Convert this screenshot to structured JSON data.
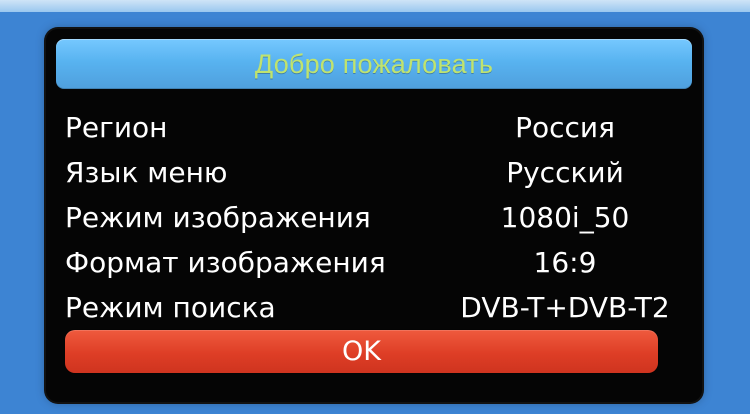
{
  "dialog": {
    "title": "Добро пожаловать",
    "settings": [
      {
        "label": "Регион",
        "value": "Россия"
      },
      {
        "label": "Язык меню",
        "value": "Русский"
      },
      {
        "label": "Режим изображения",
        "value": "1080i_50"
      },
      {
        "label": "Формат изображения",
        "value": "16:9"
      },
      {
        "label": "Режим поиска",
        "value": "DVB-T+DVB-T2"
      }
    ],
    "ok_label": "OK"
  },
  "colors": {
    "background": "#3d84d3",
    "dialog_background": "#050505",
    "title_bar": "#58b3f0",
    "title_text": "#bfe36f",
    "text": "#ffffff",
    "ok_button": "#de3e26"
  }
}
